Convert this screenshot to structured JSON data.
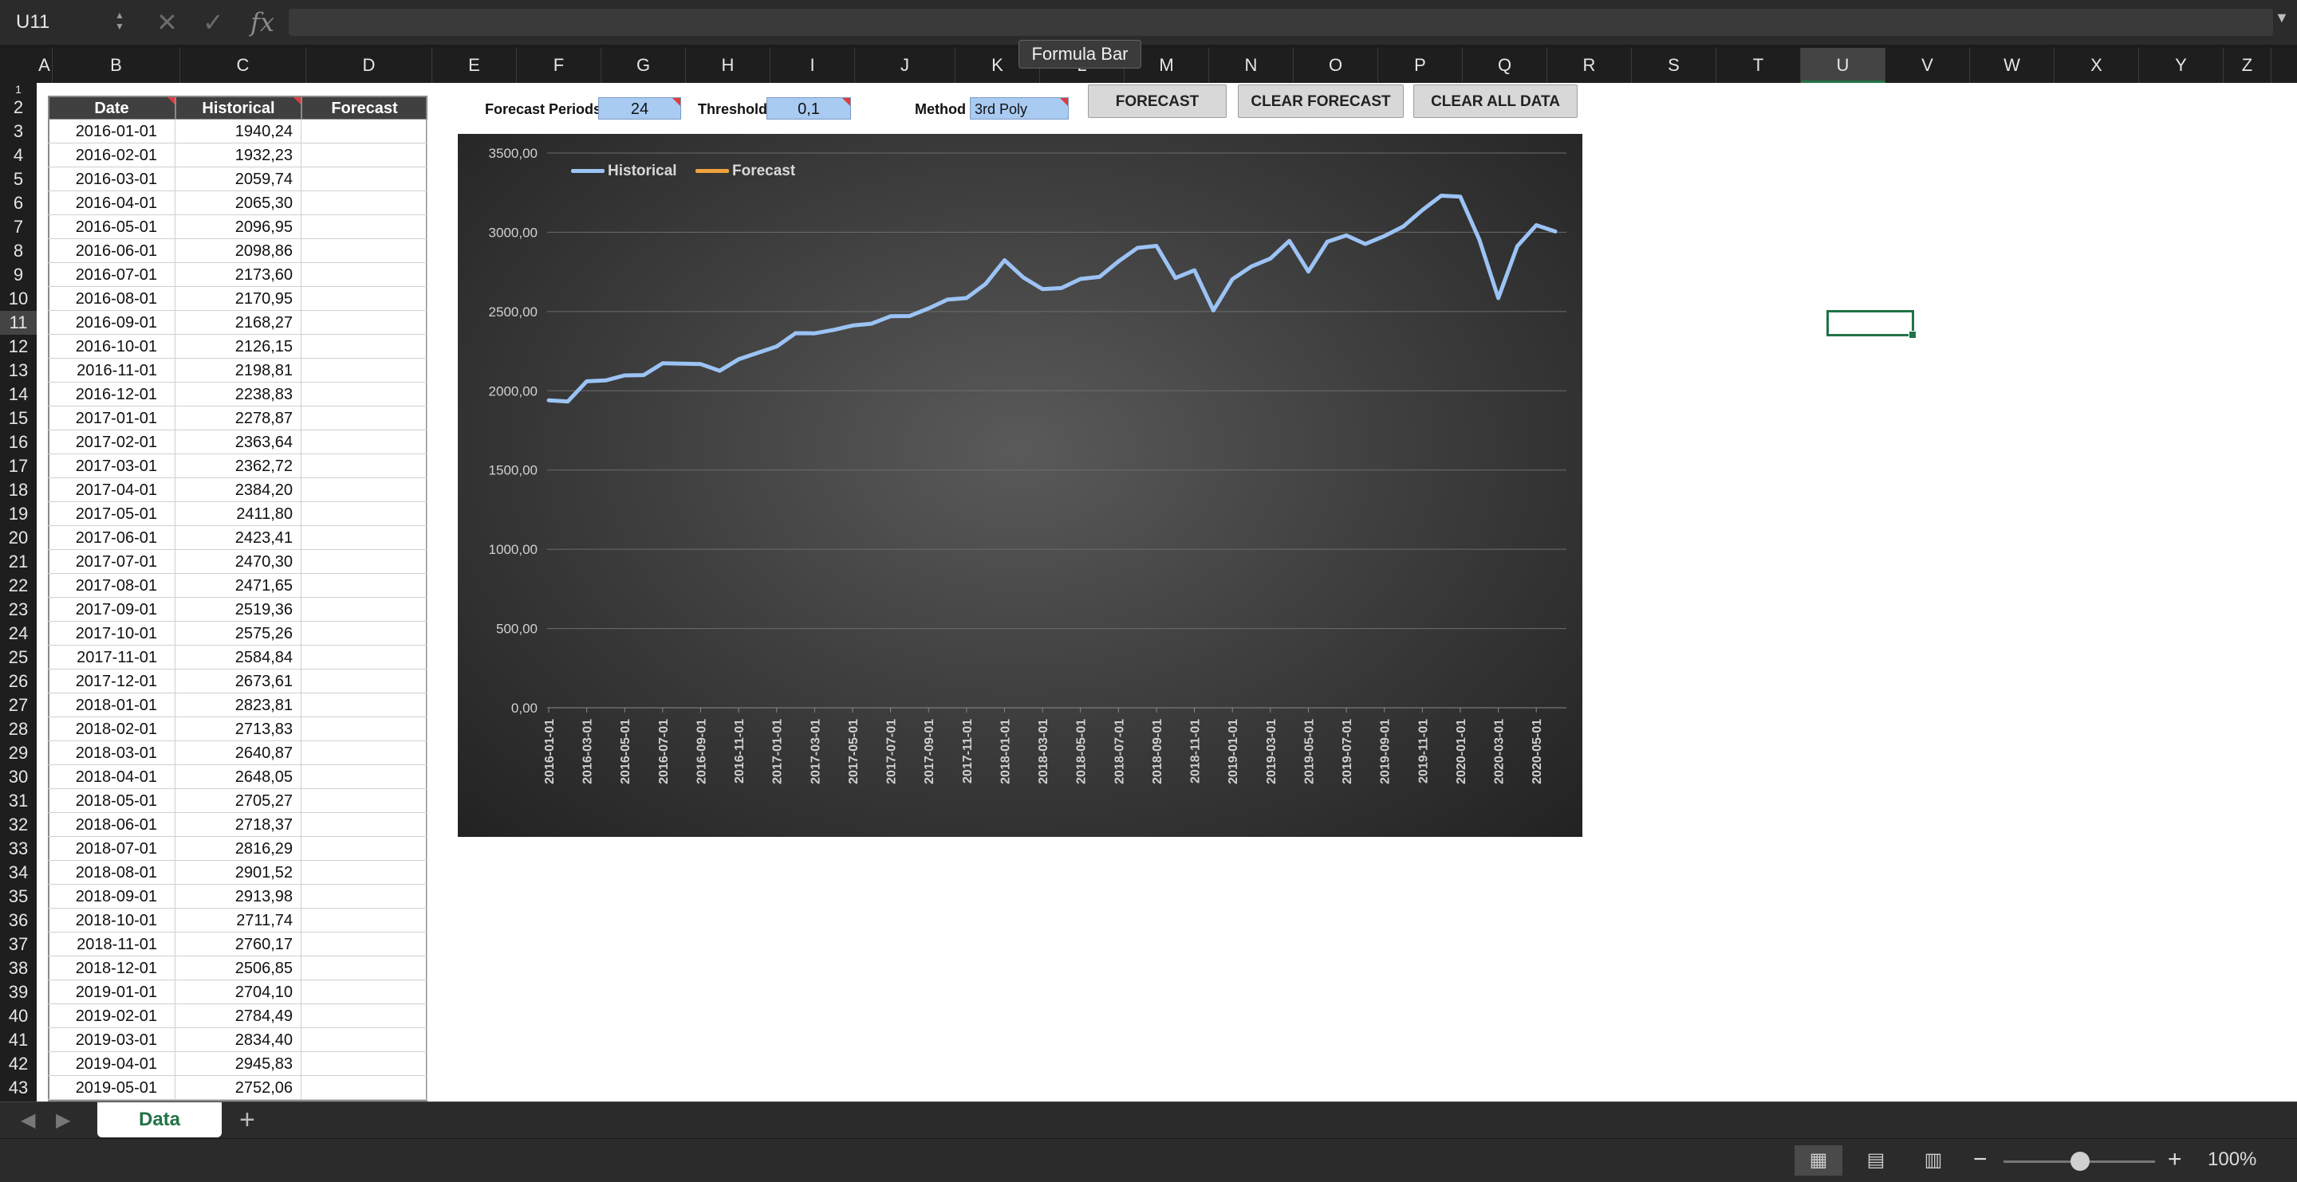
{
  "formula_bar": {
    "name_box": "U11",
    "cancel_icon": "x-icon",
    "enter_icon": "checkmark-icon",
    "function_icon": "fx",
    "tooltip": "Formula Bar",
    "value": ""
  },
  "columns": [
    "A",
    "B",
    "C",
    "D",
    "E",
    "F",
    "G",
    "H",
    "I",
    "J",
    "K",
    "L",
    "M",
    "N",
    "O",
    "P",
    "Q",
    "R",
    "S",
    "T",
    "U",
    "V",
    "W",
    "X",
    "Y",
    "Z"
  ],
  "selected_column": "U",
  "rows": [
    "1",
    "2",
    "3",
    "4",
    "5",
    "6",
    "7",
    "8",
    "9",
    "10",
    "11",
    "12",
    "13",
    "14",
    "15",
    "16",
    "17",
    "18",
    "19",
    "20",
    "21",
    "22",
    "23",
    "24",
    "25",
    "26",
    "27",
    "28",
    "29",
    "30",
    "31",
    "32",
    "33",
    "34",
    "35",
    "36",
    "37",
    "38",
    "39",
    "40",
    "41",
    "42",
    "43"
  ],
  "selected_row": "11",
  "table": {
    "headers": [
      "Date",
      "Historical",
      "Forecast"
    ],
    "rows": [
      [
        "2016-01-01",
        "1940,24"
      ],
      [
        "2016-02-01",
        "1932,23"
      ],
      [
        "2016-03-01",
        "2059,74"
      ],
      [
        "2016-04-01",
        "2065,30"
      ],
      [
        "2016-05-01",
        "2096,95"
      ],
      [
        "2016-06-01",
        "2098,86"
      ],
      [
        "2016-07-01",
        "2173,60"
      ],
      [
        "2016-08-01",
        "2170,95"
      ],
      [
        "2016-09-01",
        "2168,27"
      ],
      [
        "2016-10-01",
        "2126,15"
      ],
      [
        "2016-11-01",
        "2198,81"
      ],
      [
        "2016-12-01",
        "2238,83"
      ],
      [
        "2017-01-01",
        "2278,87"
      ],
      [
        "2017-02-01",
        "2363,64"
      ],
      [
        "2017-03-01",
        "2362,72"
      ],
      [
        "2017-04-01",
        "2384,20"
      ],
      [
        "2017-05-01",
        "2411,80"
      ],
      [
        "2017-06-01",
        "2423,41"
      ],
      [
        "2017-07-01",
        "2470,30"
      ],
      [
        "2017-08-01",
        "2471,65"
      ],
      [
        "2017-09-01",
        "2519,36"
      ],
      [
        "2017-10-01",
        "2575,26"
      ],
      [
        "2017-11-01",
        "2584,84"
      ],
      [
        "2017-12-01",
        "2673,61"
      ],
      [
        "2018-01-01",
        "2823,81"
      ],
      [
        "2018-02-01",
        "2713,83"
      ],
      [
        "2018-03-01",
        "2640,87"
      ],
      [
        "2018-04-01",
        "2648,05"
      ],
      [
        "2018-05-01",
        "2705,27"
      ],
      [
        "2018-06-01",
        "2718,37"
      ],
      [
        "2018-07-01",
        "2816,29"
      ],
      [
        "2018-08-01",
        "2901,52"
      ],
      [
        "2018-09-01",
        "2913,98"
      ],
      [
        "2018-10-01",
        "2711,74"
      ],
      [
        "2018-11-01",
        "2760,17"
      ],
      [
        "2018-12-01",
        "2506,85"
      ],
      [
        "2019-01-01",
        "2704,10"
      ],
      [
        "2019-02-01",
        "2784,49"
      ],
      [
        "2019-03-01",
        "2834,40"
      ],
      [
        "2019-04-01",
        "2945,83"
      ],
      [
        "2019-05-01",
        "2752,06"
      ]
    ]
  },
  "params": {
    "periods_label": "Forecast Periods",
    "periods_value": "24",
    "threshold_label": "Threshold",
    "threshold_value": "0,1",
    "method_label": "Method",
    "method_value": "3rd Poly"
  },
  "buttons": {
    "forecast": "FORECAST",
    "clear_forecast": "CLEAR FORECAST",
    "clear_all": "CLEAR ALL DATA"
  },
  "sheet_tabs": {
    "active": "Data",
    "add_icon": "+"
  },
  "status": {
    "zoom": "100%"
  },
  "colors": {
    "historical": "#9cc3f5",
    "forecast": "#f0a33c",
    "accent": "#217346"
  },
  "chart_data": {
    "type": "line",
    "title": "",
    "xlabel": "",
    "ylabel": "",
    "ylim": [
      0,
      3500
    ],
    "yticks": [
      "0,00",
      "500,00",
      "1000,00",
      "1500,00",
      "2000,00",
      "2500,00",
      "3000,00",
      "3500,00"
    ],
    "x": [
      "2016-01-01",
      "2016-02-01",
      "2016-03-01",
      "2016-04-01",
      "2016-05-01",
      "2016-06-01",
      "2016-07-01",
      "2016-08-01",
      "2016-09-01",
      "2016-10-01",
      "2016-11-01",
      "2016-12-01",
      "2017-01-01",
      "2017-02-01",
      "2017-03-01",
      "2017-04-01",
      "2017-05-01",
      "2017-06-01",
      "2017-07-01",
      "2017-08-01",
      "2017-09-01",
      "2017-10-01",
      "2017-11-01",
      "2017-12-01",
      "2018-01-01",
      "2018-02-01",
      "2018-03-01",
      "2018-04-01",
      "2018-05-01",
      "2018-06-01",
      "2018-07-01",
      "2018-08-01",
      "2018-09-01",
      "2018-10-01",
      "2018-11-01",
      "2018-12-01",
      "2019-01-01",
      "2019-02-01",
      "2019-03-01",
      "2019-04-01",
      "2019-05-01",
      "2019-06-01",
      "2019-07-01",
      "2019-08-01",
      "2019-09-01",
      "2019-10-01",
      "2019-11-01",
      "2019-12-01",
      "2020-01-01",
      "2020-02-01",
      "2020-03-01",
      "2020-04-01",
      "2020-05-01",
      "2020-06-01"
    ],
    "xtick_labels": [
      "2016-01-01",
      "2016-03-01",
      "2016-05-01",
      "2016-07-01",
      "2016-09-01",
      "2016-11-01",
      "2017-01-01",
      "2017-03-01",
      "2017-05-01",
      "2017-07-01",
      "2017-09-01",
      "2017-11-01",
      "2018-01-01",
      "2018-03-01",
      "2018-05-01",
      "2018-07-01",
      "2018-09-01",
      "2018-11-01",
      "2019-01-01",
      "2019-03-01",
      "2019-05-01",
      "2019-07-01",
      "2019-09-01",
      "2019-11-01",
      "2020-01-01",
      "2020-03-01",
      "2020-05-01"
    ],
    "series": [
      {
        "name": "Historical",
        "color": "#9cc3f5",
        "values": [
          1940.24,
          1932.23,
          2059.74,
          2065.3,
          2096.95,
          2098.86,
          2173.6,
          2170.95,
          2168.27,
          2126.15,
          2198.81,
          2238.83,
          2278.87,
          2363.64,
          2362.72,
          2384.2,
          2411.8,
          2423.41,
          2470.3,
          2471.65,
          2519.36,
          2575.26,
          2584.84,
          2673.61,
          2823.81,
          2713.83,
          2640.87,
          2648.05,
          2705.27,
          2718.37,
          2816.29,
          2901.52,
          2913.98,
          2711.74,
          2760.17,
          2506.85,
          2704.1,
          2784.49,
          2834.4,
          2945.83,
          2752.06,
          2941,
          2980,
          2926,
          2976,
          3037,
          3140,
          3231,
          3225,
          2954,
          2585,
          2912,
          3045,
          3005
        ]
      },
      {
        "name": "Forecast",
        "color": "#f0a33c",
        "values": []
      }
    ],
    "legend": "top-left",
    "grid": true
  }
}
